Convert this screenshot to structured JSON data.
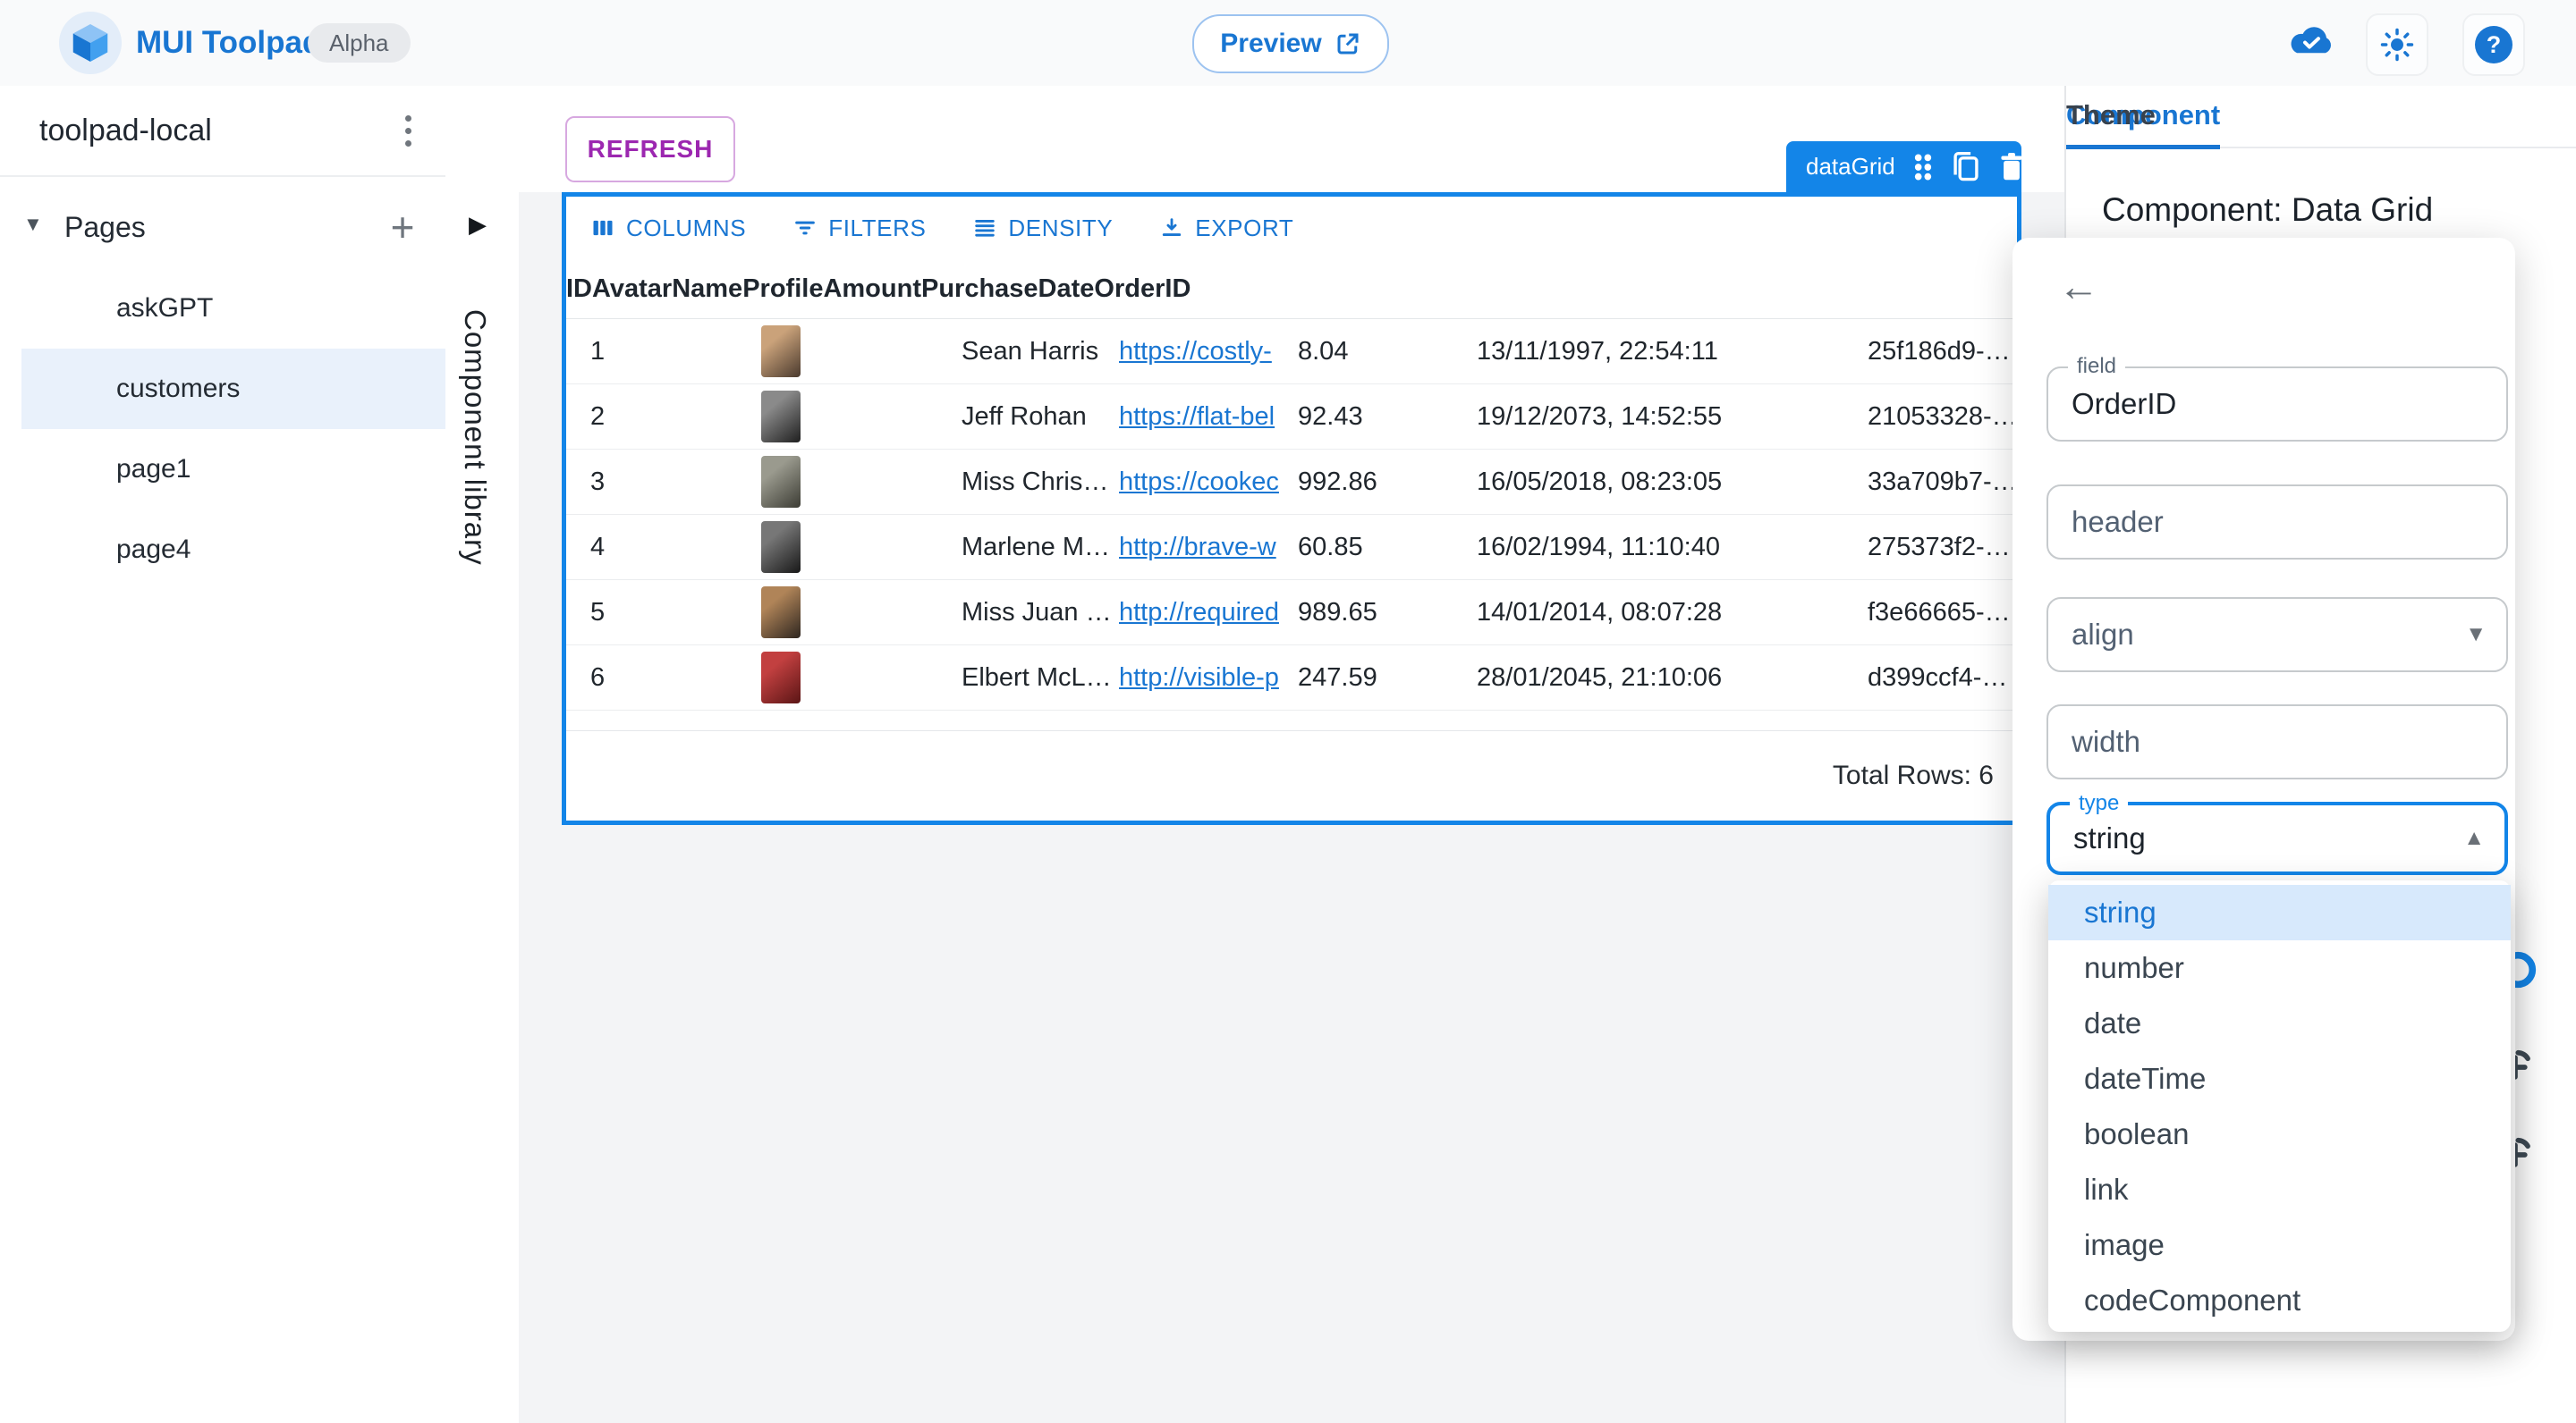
{
  "header": {
    "app_title": "MUI Toolpad",
    "alpha_badge": "Alpha",
    "preview_label": "Preview"
  },
  "sidebar": {
    "project_name": "toolpad-local",
    "pages_label": "Pages",
    "pages": [
      {
        "label": "askGPT",
        "selected": false
      },
      {
        "label": "customers",
        "selected": true
      },
      {
        "label": "page1",
        "selected": false
      },
      {
        "label": "page4",
        "selected": false
      }
    ]
  },
  "component_library": {
    "label": "Component library"
  },
  "canvas": {
    "refresh_button": "REFRESH",
    "selection_chip": "dataGrid"
  },
  "data_grid": {
    "toolbar": {
      "columns": "COLUMNS",
      "filters": "FILTERS",
      "density": "DENSITY",
      "export": "EXPORT"
    },
    "columns": [
      "ID",
      "Avatar",
      "Name",
      "Profile",
      "Amount",
      "PurchaseDate",
      "OrderID"
    ],
    "rows": [
      {
        "id": "1",
        "name": "Sean Harris",
        "profile": "https://costly-",
        "amount": "8.04",
        "purchase_date": "13/11/1997, 22:54:11",
        "order_id": "25f186d9-…",
        "avatar_colors": [
          "#caa27a",
          "#4a3a2e"
        ]
      },
      {
        "id": "2",
        "name": "Jeff Rohan",
        "profile": "https://flat-bel",
        "amount": "92.43",
        "purchase_date": "19/12/2073, 14:52:55",
        "order_id": "21053328-…",
        "avatar_colors": [
          "#8a8a8a",
          "#1f1f1f"
        ]
      },
      {
        "id": "3",
        "name": "Miss Chris…",
        "profile": "https://cookec",
        "amount": "992.86",
        "purchase_date": "16/05/2018, 08:23:05",
        "order_id": "33a709b7-…",
        "avatar_colors": [
          "#9a9a8e",
          "#3c3c34"
        ]
      },
      {
        "id": "4",
        "name": "Marlene M…",
        "profile": "http://brave-w",
        "amount": "60.85",
        "purchase_date": "16/02/1994, 11:10:40",
        "order_id": "275373f2-…",
        "avatar_colors": [
          "#777777",
          "#181818"
        ]
      },
      {
        "id": "5",
        "name": "Miss Juan …",
        "profile": "http://required",
        "amount": "989.65",
        "purchase_date": "14/01/2014, 08:07:28",
        "order_id": "f3e66665-…",
        "avatar_colors": [
          "#b08458",
          "#2e2620"
        ]
      },
      {
        "id": "6",
        "name": "Elbert McL…",
        "profile": "http://visible-p",
        "amount": "247.59",
        "purchase_date": "28/01/2045, 21:10:06",
        "order_id": "d399ccf4-…",
        "avatar_colors": [
          "#c24040",
          "#5a1515"
        ]
      }
    ],
    "footer_total": "Total Rows: 6"
  },
  "inspector": {
    "tabs": [
      {
        "label": "Component",
        "active": true
      },
      {
        "label": "Theme",
        "active": false
      }
    ],
    "heading": "Component: Data Grid"
  },
  "column_editor": {
    "field_label": "field",
    "field_value": "OrderID",
    "header_label": "header",
    "align_label": "align",
    "width_label": "width",
    "type_label": "type",
    "type_value": "string",
    "type_options": [
      {
        "label": "string",
        "selected": true
      },
      {
        "label": "number",
        "selected": false
      },
      {
        "label": "date",
        "selected": false
      },
      {
        "label": "dateTime",
        "selected": false
      },
      {
        "label": "boolean",
        "selected": false
      },
      {
        "label": "link",
        "selected": false
      },
      {
        "label": "image",
        "selected": false
      },
      {
        "label": "codeComponent",
        "selected": false
      }
    ]
  },
  "icons": {
    "logo": "toolpad-cube-icon",
    "header_right": [
      "cloud-done-icon",
      "light-mode-icon",
      "help-icon"
    ],
    "chip": [
      "drag-indicator-icon",
      "duplicate-icon",
      "delete-icon"
    ],
    "grid_toolbar": [
      "view-columns-icon",
      "filter-list-icon",
      "density-icon",
      "export-icon"
    ]
  },
  "colors": {
    "accent": "#1976d2",
    "selection_border": "#1385e8",
    "refresh": "#9c27b0",
    "selected_option_bg": "#d7e9fc",
    "selected_page_bg": "#e9f1fb"
  }
}
